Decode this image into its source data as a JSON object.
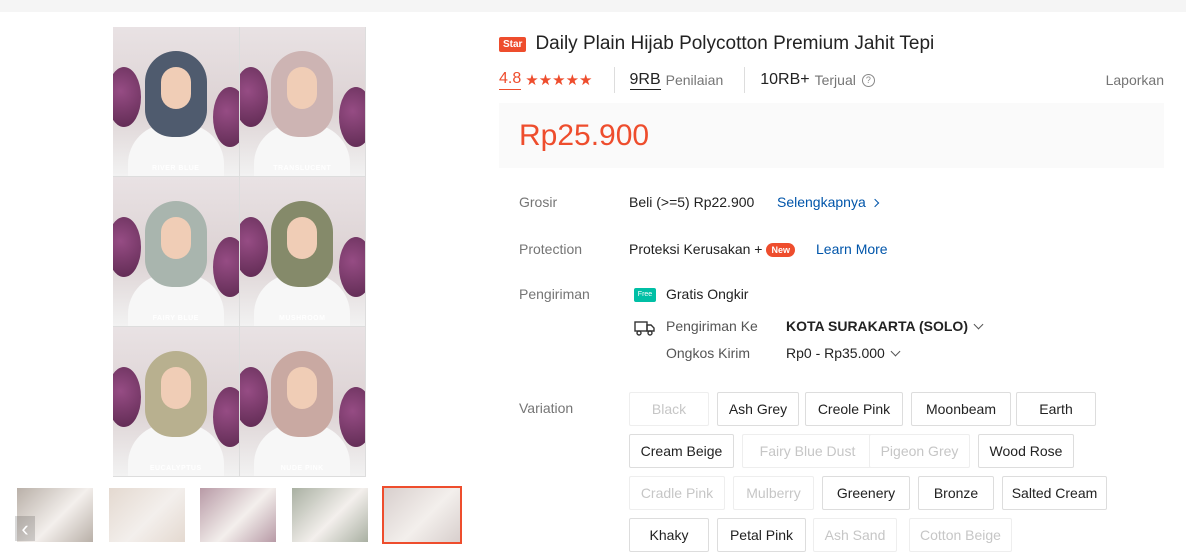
{
  "product": {
    "badge": "Star",
    "title": "Daily Plain Hijab Polycotton Premium Jahit Tepi",
    "rating": "4.8",
    "stars": "★★★★★",
    "reviews_count": "9RB",
    "reviews_label": "Penilaian",
    "sold_count": "10RB+",
    "sold_label": "Terjual",
    "report_label": "Laporkan",
    "price": "Rp25.900"
  },
  "gallery": {
    "tiles": [
      {
        "label": "RIVER BLUE",
        "color": "#4f5b6e"
      },
      {
        "label": "TRANSLUCENT",
        "color": "#cdb4b3"
      },
      {
        "label": "FAIRY BLUE",
        "color": "#a9b5ae"
      },
      {
        "label": "MUSHROOM",
        "color": "#858a6a"
      },
      {
        "label": "EUCALYPTUS",
        "color": "#b8b08f"
      },
      {
        "label": "NUDE PINK",
        "color": "#c9a9a2"
      }
    ],
    "thumbnails": [
      "#b9b0a8",
      "#e4d9d0",
      "#b89aa6",
      "#a9b0a2",
      "#d8cfcd"
    ],
    "active_thumbnail": 4
  },
  "grosir": {
    "label": "Grosir",
    "text": "Beli (>=5) Rp22.900",
    "link": "Selengkapnya"
  },
  "protection": {
    "label": "Protection",
    "text": "Proteksi Kerusakan +",
    "badge": "New",
    "link": "Learn More"
  },
  "shipping": {
    "label": "Pengiriman",
    "free_badge": "Free",
    "free_text": "Gratis Ongkir",
    "to_label": "Pengiriman Ke",
    "to_value": "KOTA SURAKARTA (SOLO)",
    "cost_label": "Ongkos Kirim",
    "cost_value": "Rp0 - Rp35.000"
  },
  "variation": {
    "label": "Variation",
    "options": [
      {
        "name": "Black",
        "disabled": true
      },
      {
        "name": "Ash Grey",
        "disabled": false
      },
      {
        "name": "Creole Pink",
        "disabled": false
      },
      {
        "name": "Moonbeam",
        "disabled": false
      },
      {
        "name": "Earth",
        "disabled": false
      },
      {
        "name": "Cream Beige",
        "disabled": false
      },
      {
        "name": "Fairy Blue Dust",
        "disabled": true
      },
      {
        "name": "Pigeon Grey",
        "disabled": true
      },
      {
        "name": "Wood Rose",
        "disabled": false
      },
      {
        "name": "Cradle Pink",
        "disabled": true
      },
      {
        "name": "Mulberry",
        "disabled": true
      },
      {
        "name": "Greenery",
        "disabled": false
      },
      {
        "name": "Bronze",
        "disabled": false
      },
      {
        "name": "Salted Cream",
        "disabled": false
      },
      {
        "name": "Khaky",
        "disabled": false
      },
      {
        "name": "Petal Pink",
        "disabled": false
      },
      {
        "name": "Ash Sand",
        "disabled": true
      },
      {
        "name": "Cotton Beige",
        "disabled": true
      }
    ]
  },
  "colors": {
    "accent": "#ee4d2d",
    "link": "#0055aa",
    "free": "#00bfa5"
  }
}
